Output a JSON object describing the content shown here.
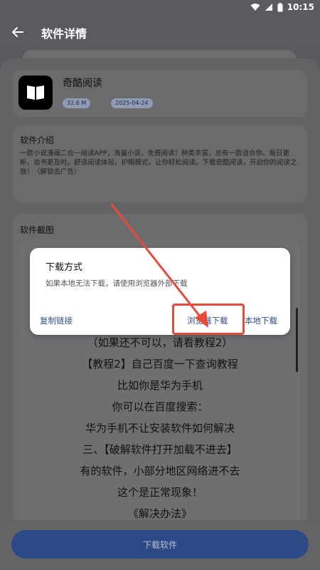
{
  "status_bar": {
    "time": "10:15"
  },
  "header": {
    "title": "软件详情"
  },
  "app": {
    "name": "奇酷阅读",
    "size": "32.6 M",
    "date": "2025-04-24"
  },
  "intro": {
    "title": "软件介绍",
    "text": "一款小说漫画二合一阅读APP，海量小说，免费阅读！种类丰富，总有一款适合你。每日更新，追书更及时。舒适阅读体验，护眼模式，让你轻松阅读。下载奇酷阅读，开启你的阅读之旅！（解锁去广告）"
  },
  "screenshots": {
    "title": "软件截图",
    "lines": [
      "（如果还不可以，请看教程2）",
      "【教程2】自己百度一下查询教程",
      "比如你是华为手机",
      "你可以在百度搜索：",
      "华为手机不让安装软件如何解决",
      "三、【破解软件打开加载不进去】",
      "有的软件，小部分地区网络进不去",
      "这个是正常现象！",
      "《解决办法》"
    ]
  },
  "dialog": {
    "title": "下载方式",
    "message": "如果本地无法下载，请使用浏览器外部下载",
    "copy_link": "复制链接",
    "browser_download": "浏览器下载",
    "local_download": "本地下载"
  },
  "footer": {
    "download_button": "下载软件"
  },
  "colors": {
    "primary": "#2e4a86",
    "annotation": "#e64a3a"
  }
}
